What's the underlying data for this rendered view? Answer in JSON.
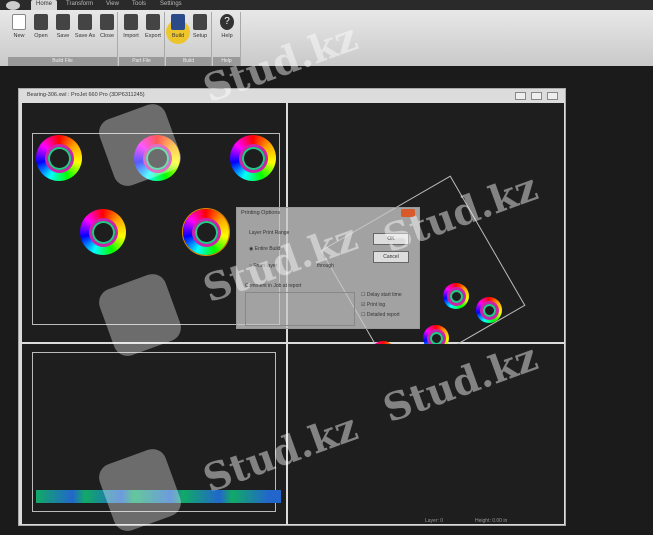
{
  "tabs": [
    "Home",
    "Transform",
    "View",
    "Tools",
    "Settings"
  ],
  "ribbon": {
    "groups": [
      {
        "label": "Build File",
        "buttons": [
          "New",
          "Open",
          "Save",
          "Save As",
          "Close"
        ]
      },
      {
        "label": "Part File",
        "buttons": [
          "Import",
          "Export"
        ]
      },
      {
        "label": "Build",
        "buttons": [
          "Build",
          "Setup"
        ]
      },
      {
        "label": "Help",
        "buttons": [
          "Help"
        ]
      }
    ]
  },
  "window": {
    "title": "Bearing-306.xwl : ProJet 660 Pro (3DP6311245)"
  },
  "dialog": {
    "title": "Printing Options",
    "range_label": "Layer Print Range",
    "entire": "Entire Build",
    "from": "From layer",
    "through": "through",
    "comment": "Comment in Job at report",
    "ok": "OK",
    "cancel": "Cancel",
    "checks": [
      "Delay start time",
      "Print log",
      "Detailed report"
    ]
  },
  "status": [
    "Layer: 0",
    "Height: 0.00 in"
  ],
  "watermark": "Stud.kz"
}
